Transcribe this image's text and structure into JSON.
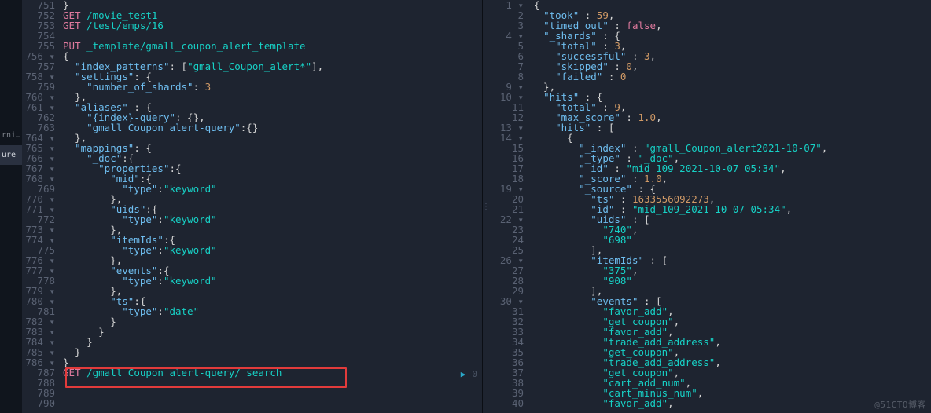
{
  "nav": {
    "items": [
      "rni…",
      "ure"
    ]
  },
  "left": {
    "start": 751,
    "end": 790,
    "highlight_line": 787,
    "lines": {
      "751": [
        {
          "c": "brace",
          "t": "}"
        }
      ],
      "752": [
        {
          "c": "m-get",
          "t": "GET "
        },
        {
          "c": "path",
          "t": "/movie_test1"
        }
      ],
      "753": [
        {
          "c": "m-get",
          "t": "GET "
        },
        {
          "c": "path",
          "t": "/test/emps/16"
        }
      ],
      "754": [],
      "755": [
        {
          "c": "m-put",
          "t": "PUT "
        },
        {
          "c": "path",
          "t": "_template/gmall_coupon_alert_template"
        }
      ],
      "756": [
        {
          "c": "brace",
          "t": "{"
        }
      ],
      "757": [
        {
          "c": "punct",
          "t": "  "
        },
        {
          "c": "key",
          "t": "\"index_patterns\""
        },
        {
          "c": "punct",
          "t": ": ["
        },
        {
          "c": "str",
          "t": "\"gmall_Coupon_alert*\""
        },
        {
          "c": "punct",
          "t": "],"
        }
      ],
      "758": [
        {
          "c": "punct",
          "t": "  "
        },
        {
          "c": "key",
          "t": "\"settings\""
        },
        {
          "c": "punct",
          "t": ": {"
        }
      ],
      "759": [
        {
          "c": "punct",
          "t": "    "
        },
        {
          "c": "key",
          "t": "\"number_of_shards\""
        },
        {
          "c": "punct",
          "t": ": "
        },
        {
          "c": "num",
          "t": "3"
        }
      ],
      "760": [
        {
          "c": "punct",
          "t": "  },"
        }
      ],
      "761": [
        {
          "c": "punct",
          "t": "  "
        },
        {
          "c": "key",
          "t": "\"aliases\""
        },
        {
          "c": "punct",
          "t": " : {"
        }
      ],
      "762": [
        {
          "c": "punct",
          "t": "    "
        },
        {
          "c": "key",
          "t": "\"{index}-query\""
        },
        {
          "c": "punct",
          "t": ": {},"
        }
      ],
      "763": [
        {
          "c": "punct",
          "t": "    "
        },
        {
          "c": "key",
          "t": "\"gmall_Coupon_alert-query\""
        },
        {
          "c": "punct",
          "t": ":{}"
        }
      ],
      "764": [
        {
          "c": "punct",
          "t": "  },"
        }
      ],
      "765": [
        {
          "c": "punct",
          "t": "  "
        },
        {
          "c": "key",
          "t": "\"mappings\""
        },
        {
          "c": "punct",
          "t": ": {"
        }
      ],
      "766": [
        {
          "c": "punct",
          "t": "    "
        },
        {
          "c": "key",
          "t": "\"_doc\""
        },
        {
          "c": "punct",
          "t": ":{"
        }
      ],
      "767": [
        {
          "c": "punct",
          "t": "      "
        },
        {
          "c": "key",
          "t": "\"properties\""
        },
        {
          "c": "punct",
          "t": ":{"
        }
      ],
      "768": [
        {
          "c": "punct",
          "t": "        "
        },
        {
          "c": "key",
          "t": "\"mid\""
        },
        {
          "c": "punct",
          "t": ":{"
        }
      ],
      "769": [
        {
          "c": "punct",
          "t": "          "
        },
        {
          "c": "key",
          "t": "\"type\""
        },
        {
          "c": "punct",
          "t": ":"
        },
        {
          "c": "str",
          "t": "\"keyword\""
        }
      ],
      "770": [
        {
          "c": "punct",
          "t": "        },"
        }
      ],
      "771": [
        {
          "c": "punct",
          "t": "        "
        },
        {
          "c": "key",
          "t": "\"uids\""
        },
        {
          "c": "punct",
          "t": ":{"
        }
      ],
      "772": [
        {
          "c": "punct",
          "t": "          "
        },
        {
          "c": "key",
          "t": "\"type\""
        },
        {
          "c": "punct",
          "t": ":"
        },
        {
          "c": "str",
          "t": "\"keyword\""
        }
      ],
      "773": [
        {
          "c": "punct",
          "t": "        },"
        }
      ],
      "774": [
        {
          "c": "punct",
          "t": "        "
        },
        {
          "c": "key",
          "t": "\"itemIds\""
        },
        {
          "c": "punct",
          "t": ":{"
        }
      ],
      "775": [
        {
          "c": "punct",
          "t": "          "
        },
        {
          "c": "key",
          "t": "\"type\""
        },
        {
          "c": "punct",
          "t": ":"
        },
        {
          "c": "str",
          "t": "\"keyword\""
        }
      ],
      "776": [
        {
          "c": "punct",
          "t": "        },"
        }
      ],
      "777": [
        {
          "c": "punct",
          "t": "        "
        },
        {
          "c": "key",
          "t": "\"events\""
        },
        {
          "c": "punct",
          "t": ":{"
        }
      ],
      "778": [
        {
          "c": "punct",
          "t": "          "
        },
        {
          "c": "key",
          "t": "\"type\""
        },
        {
          "c": "punct",
          "t": ":"
        },
        {
          "c": "str",
          "t": "\"keyword\""
        }
      ],
      "779": [
        {
          "c": "punct",
          "t": "        },"
        }
      ],
      "780": [
        {
          "c": "punct",
          "t": "        "
        },
        {
          "c": "key",
          "t": "\"ts\""
        },
        {
          "c": "punct",
          "t": ":{"
        }
      ],
      "781": [
        {
          "c": "punct",
          "t": "          "
        },
        {
          "c": "key",
          "t": "\"type\""
        },
        {
          "c": "punct",
          "t": ":"
        },
        {
          "c": "str",
          "t": "\"date\""
        }
      ],
      "782": [
        {
          "c": "punct",
          "t": "        }"
        }
      ],
      "783": [
        {
          "c": "punct",
          "t": "      }"
        }
      ],
      "784": [
        {
          "c": "punct",
          "t": "    }"
        }
      ],
      "785": [
        {
          "c": "punct",
          "t": "  }"
        }
      ],
      "786": [
        {
          "c": "brace",
          "t": "}"
        }
      ],
      "787": [
        {
          "c": "m-get",
          "t": "GET "
        },
        {
          "c": "path",
          "t": "/gmall_Coupon_alert-query/_search"
        }
      ],
      "788": [],
      "789": [],
      "790": []
    },
    "fold_markers": [
      756,
      758,
      760,
      761,
      764,
      765,
      766,
      767,
      768,
      770,
      771,
      773,
      774,
      776,
      777,
      779,
      780,
      782,
      783,
      784,
      785,
      786
    ],
    "run_badge": "0"
  },
  "right": {
    "start": 1,
    "end": 40,
    "cursor_line": 1,
    "lines": {
      "1": [
        {
          "c": "brace",
          "t": "{"
        }
      ],
      "2": [
        {
          "c": "punct",
          "t": "  "
        },
        {
          "c": "key",
          "t": "\"took\""
        },
        {
          "c": "punct",
          "t": " : "
        },
        {
          "c": "num",
          "t": "59"
        },
        {
          "c": "punct",
          "t": ","
        }
      ],
      "3": [
        {
          "c": "punct",
          "t": "  "
        },
        {
          "c": "key",
          "t": "\"timed_out\""
        },
        {
          "c": "punct",
          "t": " : "
        },
        {
          "c": "m-bool",
          "t": "false"
        },
        {
          "c": "punct",
          "t": ","
        }
      ],
      "4": [
        {
          "c": "punct",
          "t": "  "
        },
        {
          "c": "key",
          "t": "\"_shards\""
        },
        {
          "c": "punct",
          "t": " : {"
        }
      ],
      "5": [
        {
          "c": "punct",
          "t": "    "
        },
        {
          "c": "key",
          "t": "\"total\""
        },
        {
          "c": "punct",
          "t": " : "
        },
        {
          "c": "num",
          "t": "3"
        },
        {
          "c": "punct",
          "t": ","
        }
      ],
      "6": [
        {
          "c": "punct",
          "t": "    "
        },
        {
          "c": "key",
          "t": "\"successful\""
        },
        {
          "c": "punct",
          "t": " : "
        },
        {
          "c": "num",
          "t": "3"
        },
        {
          "c": "punct",
          "t": ","
        }
      ],
      "7": [
        {
          "c": "punct",
          "t": "    "
        },
        {
          "c": "key",
          "t": "\"skipped\""
        },
        {
          "c": "punct",
          "t": " : "
        },
        {
          "c": "num",
          "t": "0"
        },
        {
          "c": "punct",
          "t": ","
        }
      ],
      "8": [
        {
          "c": "punct",
          "t": "    "
        },
        {
          "c": "key",
          "t": "\"failed\""
        },
        {
          "c": "punct",
          "t": " : "
        },
        {
          "c": "num",
          "t": "0"
        }
      ],
      "9": [
        {
          "c": "punct",
          "t": "  },"
        }
      ],
      "10": [
        {
          "c": "punct",
          "t": "  "
        },
        {
          "c": "key",
          "t": "\"hits\""
        },
        {
          "c": "punct",
          "t": " : {"
        }
      ],
      "11": [
        {
          "c": "punct",
          "t": "    "
        },
        {
          "c": "key",
          "t": "\"total\""
        },
        {
          "c": "punct",
          "t": " : "
        },
        {
          "c": "num",
          "t": "9"
        },
        {
          "c": "punct",
          "t": ","
        }
      ],
      "12": [
        {
          "c": "punct",
          "t": "    "
        },
        {
          "c": "key",
          "t": "\"max_score\""
        },
        {
          "c": "punct",
          "t": " : "
        },
        {
          "c": "num",
          "t": "1.0"
        },
        {
          "c": "punct",
          "t": ","
        }
      ],
      "13": [
        {
          "c": "punct",
          "t": "    "
        },
        {
          "c": "key",
          "t": "\"hits\""
        },
        {
          "c": "punct",
          "t": " : ["
        }
      ],
      "14": [
        {
          "c": "punct",
          "t": "      {"
        }
      ],
      "15": [
        {
          "c": "punct",
          "t": "        "
        },
        {
          "c": "key",
          "t": "\"_index\""
        },
        {
          "c": "punct",
          "t": " : "
        },
        {
          "c": "str",
          "t": "\"gmall_Coupon_alert2021-10-07\""
        },
        {
          "c": "punct",
          "t": ","
        }
      ],
      "16": [
        {
          "c": "punct",
          "t": "        "
        },
        {
          "c": "key",
          "t": "\"_type\""
        },
        {
          "c": "punct",
          "t": " : "
        },
        {
          "c": "str",
          "t": "\"_doc\""
        },
        {
          "c": "punct",
          "t": ","
        }
      ],
      "17": [
        {
          "c": "punct",
          "t": "        "
        },
        {
          "c": "key",
          "t": "\"_id\""
        },
        {
          "c": "punct",
          "t": " : "
        },
        {
          "c": "str",
          "t": "\"mid_109_2021-10-07 05:34\""
        },
        {
          "c": "punct",
          "t": ","
        }
      ],
      "18": [
        {
          "c": "punct",
          "t": "        "
        },
        {
          "c": "key",
          "t": "\"_score\""
        },
        {
          "c": "punct",
          "t": " : "
        },
        {
          "c": "num",
          "t": "1.0"
        },
        {
          "c": "punct",
          "t": ","
        }
      ],
      "19": [
        {
          "c": "punct",
          "t": "        "
        },
        {
          "c": "key",
          "t": "\"_source\""
        },
        {
          "c": "punct",
          "t": " : {"
        }
      ],
      "20": [
        {
          "c": "punct",
          "t": "          "
        },
        {
          "c": "key",
          "t": "\"ts\""
        },
        {
          "c": "punct",
          "t": " : "
        },
        {
          "c": "num",
          "t": "1633556092273"
        },
        {
          "c": "punct",
          "t": ","
        }
      ],
      "21": [
        {
          "c": "punct",
          "t": "          "
        },
        {
          "c": "key",
          "t": "\"id\""
        },
        {
          "c": "punct",
          "t": " : "
        },
        {
          "c": "str",
          "t": "\"mid_109_2021-10-07 05:34\""
        },
        {
          "c": "punct",
          "t": ","
        }
      ],
      "22": [
        {
          "c": "punct",
          "t": "          "
        },
        {
          "c": "key",
          "t": "\"uids\""
        },
        {
          "c": "punct",
          "t": " : ["
        }
      ],
      "23": [
        {
          "c": "punct",
          "t": "            "
        },
        {
          "c": "str",
          "t": "\"740\""
        },
        {
          "c": "punct",
          "t": ","
        }
      ],
      "24": [
        {
          "c": "punct",
          "t": "            "
        },
        {
          "c": "str",
          "t": "\"698\""
        }
      ],
      "25": [
        {
          "c": "punct",
          "t": "          ],"
        }
      ],
      "26": [
        {
          "c": "punct",
          "t": "          "
        },
        {
          "c": "key",
          "t": "\"itemIds\""
        },
        {
          "c": "punct",
          "t": " : ["
        }
      ],
      "27": [
        {
          "c": "punct",
          "t": "            "
        },
        {
          "c": "str",
          "t": "\"375\""
        },
        {
          "c": "punct",
          "t": ","
        }
      ],
      "28": [
        {
          "c": "punct",
          "t": "            "
        },
        {
          "c": "str",
          "t": "\"908\""
        }
      ],
      "29": [
        {
          "c": "punct",
          "t": "          ],"
        }
      ],
      "30": [
        {
          "c": "punct",
          "t": "          "
        },
        {
          "c": "key",
          "t": "\"events\""
        },
        {
          "c": "punct",
          "t": " : ["
        }
      ],
      "31": [
        {
          "c": "punct",
          "t": "            "
        },
        {
          "c": "str",
          "t": "\"favor_add\""
        },
        {
          "c": "punct",
          "t": ","
        }
      ],
      "32": [
        {
          "c": "punct",
          "t": "            "
        },
        {
          "c": "str",
          "t": "\"get_coupon\""
        },
        {
          "c": "punct",
          "t": ","
        }
      ],
      "33": [
        {
          "c": "punct",
          "t": "            "
        },
        {
          "c": "str",
          "t": "\"favor_add\""
        },
        {
          "c": "punct",
          "t": ","
        }
      ],
      "34": [
        {
          "c": "punct",
          "t": "            "
        },
        {
          "c": "str",
          "t": "\"trade_add_address\""
        },
        {
          "c": "punct",
          "t": ","
        }
      ],
      "35": [
        {
          "c": "punct",
          "t": "            "
        },
        {
          "c": "str",
          "t": "\"get_coupon\""
        },
        {
          "c": "punct",
          "t": ","
        }
      ],
      "36": [
        {
          "c": "punct",
          "t": "            "
        },
        {
          "c": "str",
          "t": "\"trade_add_address\""
        },
        {
          "c": "punct",
          "t": ","
        }
      ],
      "37": [
        {
          "c": "punct",
          "t": "            "
        },
        {
          "c": "str",
          "t": "\"get_coupon\""
        },
        {
          "c": "punct",
          "t": ","
        }
      ],
      "38": [
        {
          "c": "punct",
          "t": "            "
        },
        {
          "c": "str",
          "t": "\"cart_add_num\""
        },
        {
          "c": "punct",
          "t": ","
        }
      ],
      "39": [
        {
          "c": "punct",
          "t": "            "
        },
        {
          "c": "str",
          "t": "\"cart_minus_num\""
        },
        {
          "c": "punct",
          "t": ","
        }
      ],
      "40": [
        {
          "c": "punct",
          "t": "            "
        },
        {
          "c": "str",
          "t": "\"favor_add\""
        },
        {
          "c": "punct",
          "t": ","
        }
      ]
    },
    "fold_markers": [
      1,
      4,
      9,
      10,
      13,
      14,
      19,
      22,
      26,
      30
    ]
  },
  "watermark": "@51CTO博客"
}
